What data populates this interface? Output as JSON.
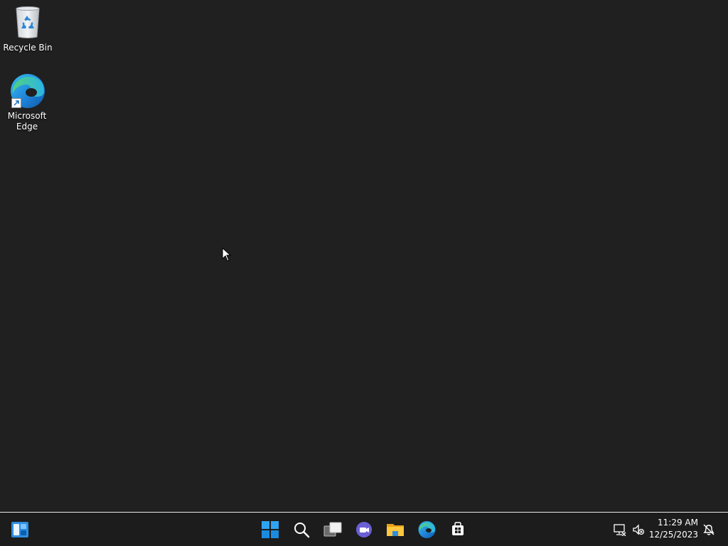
{
  "desktop": {
    "background": "#202020",
    "icons": [
      {
        "label": "Recycle Bin",
        "icon": "recycle-bin-icon"
      },
      {
        "label": "Microsoft\nEdge",
        "icon": "edge-icon"
      }
    ]
  },
  "taskbar": {
    "background": "#1c1c1c",
    "pinned": [
      {
        "name": "widgets-button",
        "icon": "widgets-icon"
      },
      {
        "name": "start-button",
        "icon": "windows-logo-icon"
      },
      {
        "name": "search-button",
        "icon": "search-icon"
      },
      {
        "name": "task-view-button",
        "icon": "task-view-icon"
      },
      {
        "name": "chat-button",
        "icon": "teams-chat-icon"
      },
      {
        "name": "file-explorer-button",
        "icon": "folder-icon"
      },
      {
        "name": "edge-button",
        "icon": "edge-icon"
      },
      {
        "name": "store-button",
        "icon": "store-icon"
      }
    ],
    "tray": {
      "network_icon": "network-disconnected-icon",
      "volume_icon": "volume-muted-icon",
      "time": "11:29 AM",
      "date": "12/25/2023",
      "notification_icon": "notification-bell-icon"
    }
  }
}
